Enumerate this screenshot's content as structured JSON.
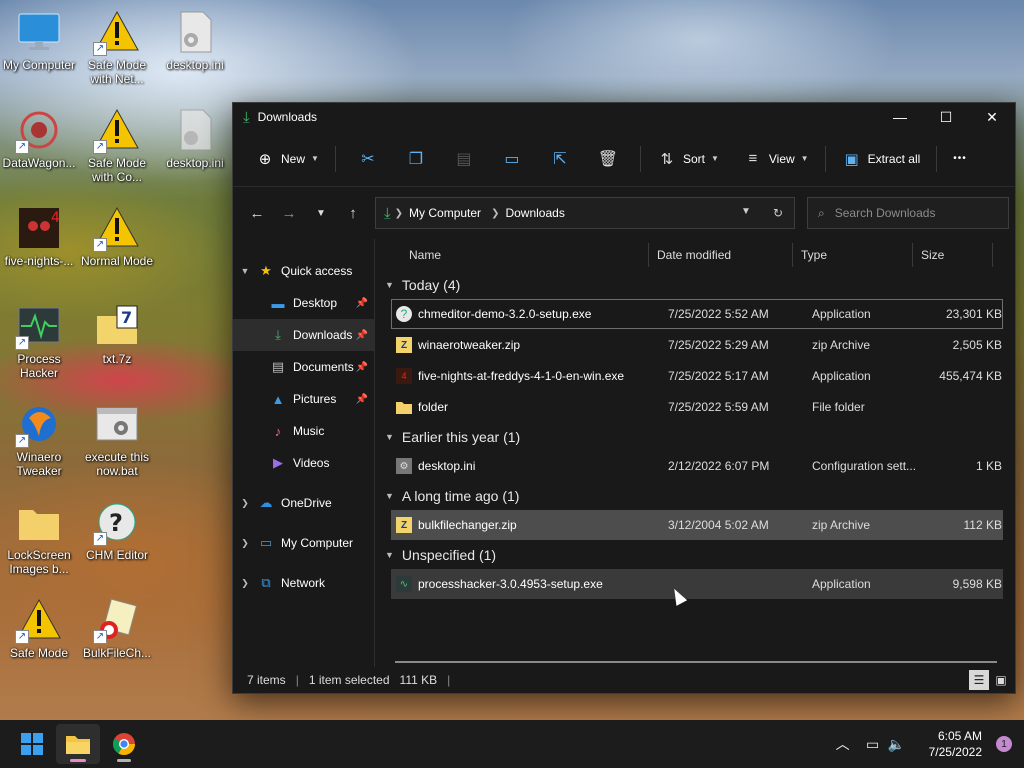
{
  "desktop": {
    "icons": [
      {
        "label": "My Computer"
      },
      {
        "label": "Safe Mode with Net..."
      },
      {
        "label": "desktop.ini"
      },
      {
        "label": "DataWagon..."
      },
      {
        "label": "Safe Mode with Co..."
      },
      {
        "label": "desktop.ini"
      },
      {
        "label": "five-nights-..."
      },
      {
        "label": "Normal Mode"
      },
      {
        "label": "Process Hacker"
      },
      {
        "label": "txt.7z"
      },
      {
        "label": "Winaero Tweaker"
      },
      {
        "label": "execute this now.bat"
      },
      {
        "label": "LockScreen Images b..."
      },
      {
        "label": "CHM Editor"
      },
      {
        "label": "Safe Mode"
      },
      {
        "label": "BulkFileCh..."
      }
    ]
  },
  "window": {
    "title": "Downloads",
    "controls": {
      "minimize": "—",
      "maximize": "☐",
      "close": "✕"
    }
  },
  "toolbar": {
    "new_label": "New",
    "sort_label": "Sort",
    "view_label": "View",
    "extract_label": "Extract all",
    "more_label": "•••"
  },
  "address": {
    "crumbs": [
      "My Computer",
      "Downloads"
    ]
  },
  "search": {
    "placeholder": "Search Downloads"
  },
  "nav_pane": {
    "quick_access": "Quick access",
    "items": [
      "Desktop",
      "Downloads",
      "Documents",
      "Pictures",
      "Music",
      "Videos"
    ],
    "onedrive": "OneDrive",
    "my_computer": "My Computer",
    "network": "Network"
  },
  "columns": {
    "name": "Name",
    "date": "Date modified",
    "type": "Type",
    "size": "Size"
  },
  "groups": [
    {
      "label": "Today (4)",
      "files": [
        {
          "name": "chmeditor-demo-3.2.0-setup.exe",
          "date": "7/25/2022 5:52 AM",
          "type": "Application",
          "size": "23,301 KB"
        },
        {
          "name": "winaerotweaker.zip",
          "date": "7/25/2022 5:29 AM",
          "type": "zip Archive",
          "size": "2,505 KB"
        },
        {
          "name": "five-nights-at-freddys-4-1-0-en-win.exe",
          "date": "7/25/2022 5:17 AM",
          "type": "Application",
          "size": "455,474 KB"
        },
        {
          "name": "folder",
          "date": "7/25/2022 5:59 AM",
          "type": "File folder",
          "size": ""
        }
      ]
    },
    {
      "label": "Earlier this year (1)",
      "files": [
        {
          "name": "desktop.ini",
          "date": "2/12/2022 6:07 PM",
          "type": "Configuration sett...",
          "size": "1 KB"
        }
      ]
    },
    {
      "label": "A long time ago (1)",
      "files": [
        {
          "name": "bulkfilechanger.zip",
          "date": "3/12/2004 5:02 AM",
          "type": "zip Archive",
          "size": "112 KB"
        }
      ]
    },
    {
      "label": "Unspecified (1)",
      "files": [
        {
          "name": "processhacker-3.0.4953-setup.exe",
          "date": "",
          "type": "Application",
          "size": "9,598 KB"
        }
      ]
    }
  ],
  "status": {
    "count": "7 items",
    "selected": "1 item selected",
    "size": "111 KB"
  },
  "taskbar": {
    "time": "6:05 AM",
    "date": "7/25/2022",
    "notifications": "1"
  },
  "colors": {
    "accent": "#5fb2f2",
    "window_bg": "#191919",
    "selected_row": "#4d4d4d"
  }
}
